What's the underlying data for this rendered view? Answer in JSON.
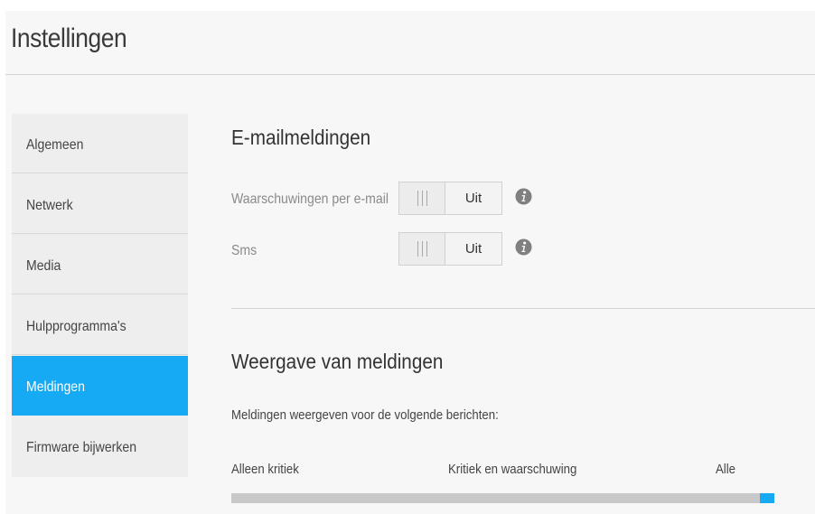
{
  "page": {
    "title": "Instellingen"
  },
  "sidebar": {
    "items": [
      {
        "label": "Algemeen",
        "active": false
      },
      {
        "label": "Netwerk",
        "active": false
      },
      {
        "label": "Media",
        "active": false
      },
      {
        "label": "Hulpprogramma's",
        "active": false
      },
      {
        "label": "Meldingen",
        "active": true
      },
      {
        "label": "Firmware bijwerken",
        "active": false
      }
    ]
  },
  "email_section": {
    "title": "E-mailmeldingen",
    "rows": [
      {
        "label": "Waarschuwingen per e-mail",
        "toggle_value": "Uit",
        "icon": "info-icon"
      },
      {
        "label": "Sms",
        "toggle_value": "Uit",
        "icon": "info-icon"
      }
    ]
  },
  "display_section": {
    "title": "Weergave van meldingen",
    "description": "Meldingen weergeven voor de volgende berichten:",
    "slider": {
      "labels": [
        "Alleen kritiek",
        "Kritiek en waarschuwing",
        "Alle"
      ],
      "selected": "Alle",
      "level": 1.0
    }
  },
  "colors": {
    "accent": "#16a9f4",
    "sidebar_bg": "#eeeeee",
    "panel_bg": "#f7f7f7",
    "track": "#c8c8c8",
    "info_icon": "#808080"
  }
}
